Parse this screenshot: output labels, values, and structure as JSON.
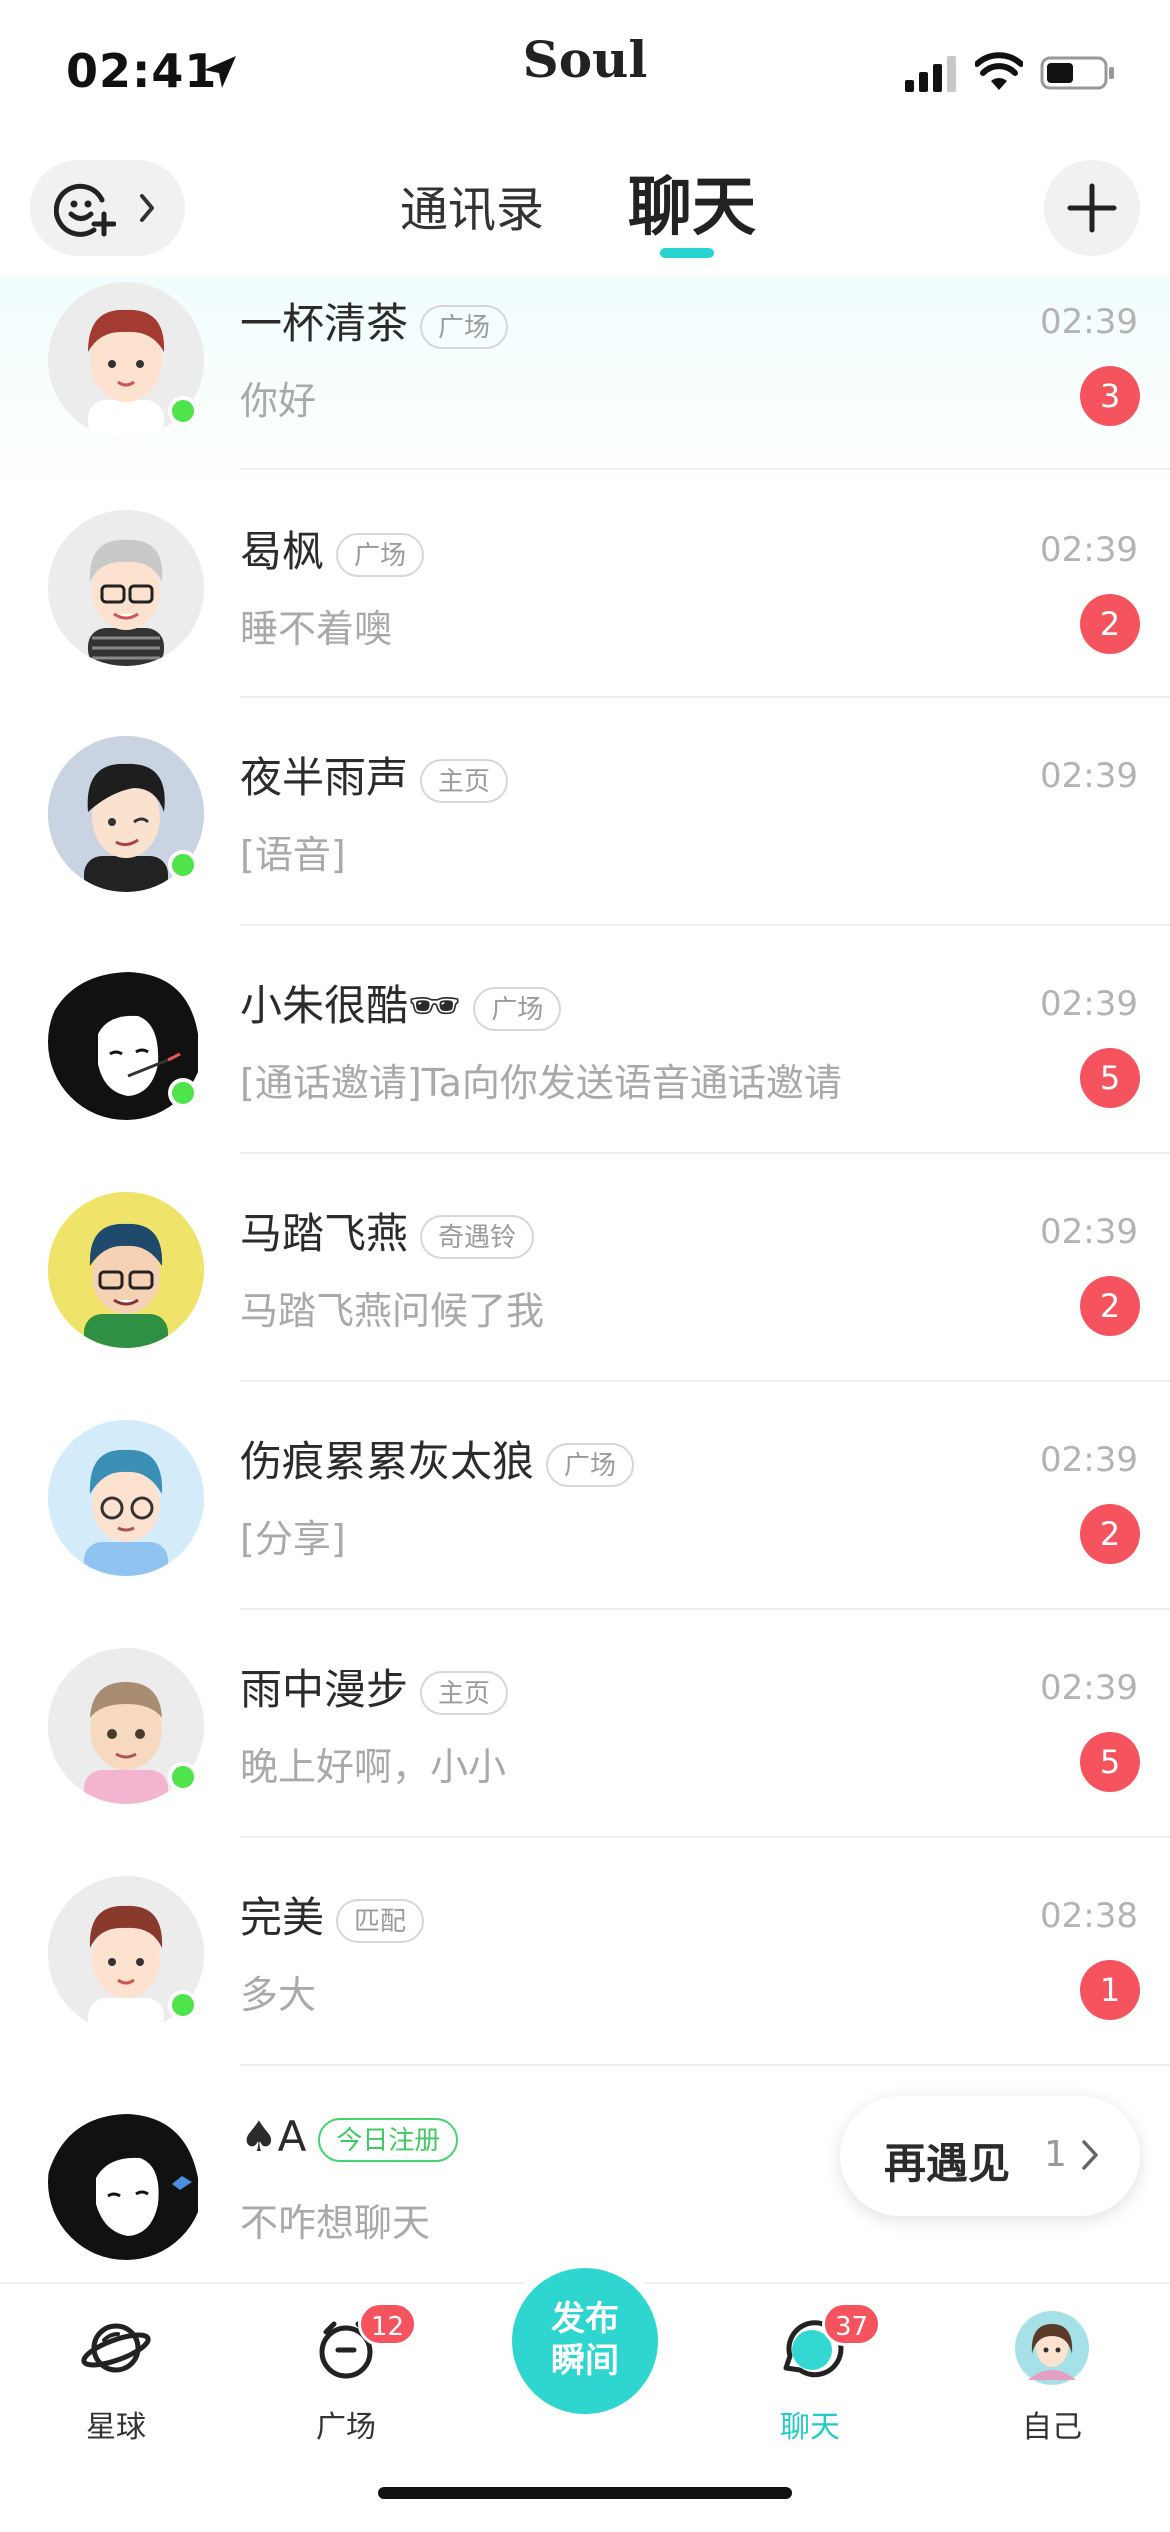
{
  "status_bar": {
    "time": "02:41",
    "app_logo": "Soul"
  },
  "header": {
    "tab_contacts": "通讯录",
    "tab_chat": "聊天"
  },
  "chats": [
    {
      "name": "一杯清茶",
      "tag": "广场",
      "time": "02:39",
      "preview": "你好",
      "unread": "3",
      "online": true
    },
    {
      "name": "曷枫",
      "tag": "广场",
      "time": "02:39",
      "preview": "睡不着噢",
      "unread": "2",
      "online": false
    },
    {
      "name": "夜半雨声",
      "tag": "主页",
      "time": "02:39",
      "preview": "[语音]",
      "unread": "",
      "online": true
    },
    {
      "name": "小朱很酷🕶",
      "tag": "广场",
      "time": "02:39",
      "preview": "[通话邀请]Ta向你发送语音通话邀请",
      "unread": "5",
      "online": true
    },
    {
      "name": "马踏飞燕",
      "tag": "奇遇铃",
      "time": "02:39",
      "preview": "马踏飞燕问候了我",
      "unread": "2",
      "online": false
    },
    {
      "name": "伤痕累累灰太狼",
      "tag": "广场",
      "time": "02:39",
      "preview": "[分享]",
      "unread": "2",
      "online": false
    },
    {
      "name": "雨中漫步",
      "tag": "主页",
      "time": "02:39",
      "preview": "晚上好啊，小小",
      "unread": "5",
      "online": true
    },
    {
      "name": "完美",
      "tag": "匹配",
      "time": "02:38",
      "preview": "多大",
      "unread": "1",
      "online": true
    },
    {
      "name": "♠A",
      "tag": "今日注册",
      "time": "",
      "preview": "不咋想聊天",
      "unread": "",
      "online": false
    }
  ],
  "meet_again": {
    "label": "再遇见",
    "count": "1"
  },
  "bottom_nav": {
    "planet": "星球",
    "square": "广场",
    "square_badge": "12",
    "publish": "发布瞬间",
    "chat": "聊天",
    "chat_badge": "37",
    "me": "自己"
  },
  "colors": {
    "accent": "#25d4d0",
    "badge_red": "#f5535e",
    "online_green": "#4fe34c"
  }
}
